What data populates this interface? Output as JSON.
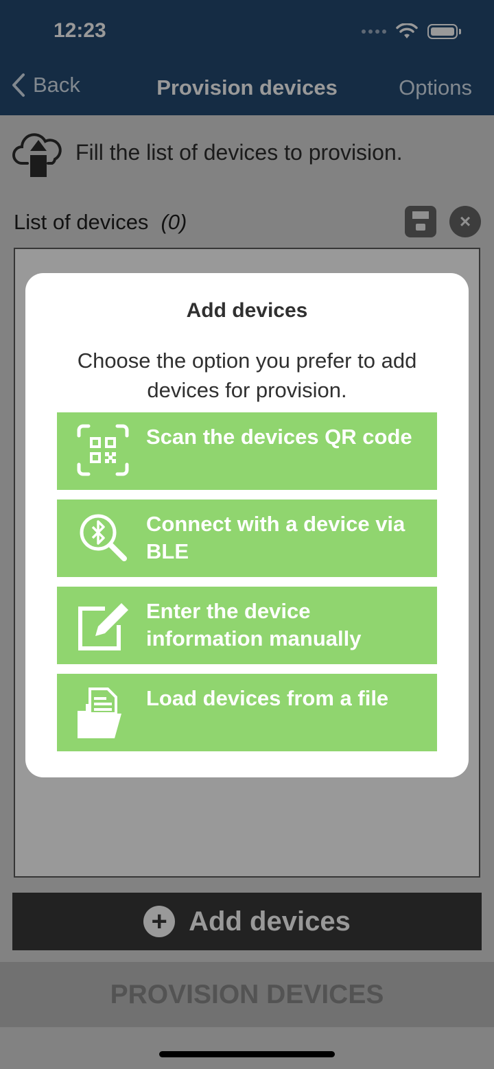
{
  "status_bar": {
    "time": "12:23"
  },
  "nav": {
    "back": "Back",
    "title": "Provision devices",
    "options": "Options"
  },
  "info": {
    "text": "Fill the list of devices to provision."
  },
  "list": {
    "label": "List of devices",
    "count": "(0)"
  },
  "add_button": {
    "label": "Add devices",
    "plus": "+"
  },
  "provision_button": {
    "label": "PROVISION DEVICES"
  },
  "modal": {
    "title": "Add devices",
    "description": "Choose the option you prefer to add devices for provision.",
    "options": [
      {
        "label": "Scan the devices QR code",
        "icon": "qr-code-icon"
      },
      {
        "label": "Connect with a device via BLE",
        "icon": "bluetooth-search-icon"
      },
      {
        "label": "Enter the device information manually",
        "icon": "edit-icon"
      },
      {
        "label": "Load devices from a file",
        "icon": "file-folder-icon"
      }
    ]
  },
  "colors": {
    "navbar": "#234a72",
    "option": "#90d56f",
    "add_button": "#3a3a3a"
  }
}
